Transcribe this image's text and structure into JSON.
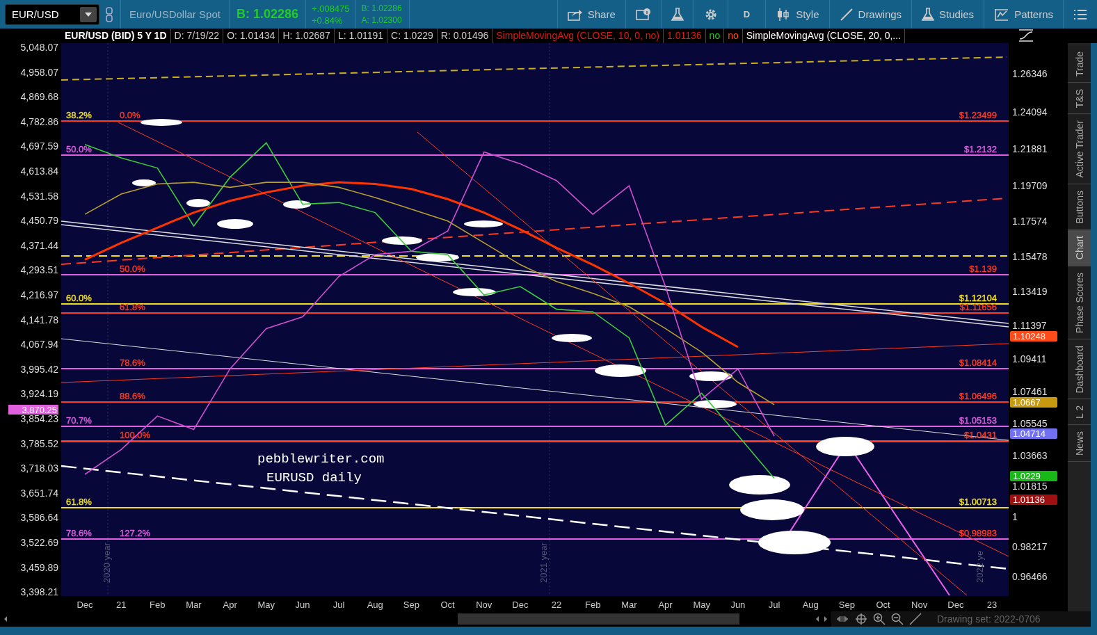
{
  "toolbar": {
    "symbol": "EUR/USD",
    "description": "Euro/USDollar Spot",
    "bid_large": "B: 1.02286",
    "change": "+.008475",
    "change_percent": "+0.84%",
    "bid": "B: 1.02286",
    "ask": "A: 1.02300",
    "buttons": [
      {
        "kind": "share",
        "label": "Share"
      },
      {
        "kind": "info"
      },
      {
        "kind": "flask"
      },
      {
        "kind": "gear"
      },
      {
        "kind": "text",
        "label": "D"
      },
      {
        "kind": "style",
        "label": "Style"
      },
      {
        "kind": "drawings",
        "label": "Drawings"
      },
      {
        "kind": "flask",
        "label": "Studies"
      },
      {
        "kind": "patterns",
        "label": "Patterns"
      },
      {
        "kind": "menu"
      }
    ]
  },
  "header": {
    "title": "EUR/USD (BID) 5 Y 1D",
    "fields": [
      "D: 7/19/22",
      "O: 1.01434",
      "H: 1.02687",
      "L: 1.01191",
      "C: 1.0229",
      "R: 0.01496"
    ],
    "studies": [
      {
        "text": "SimpleMovingAvg (CLOSE, 10, 0, no)",
        "kind": "name"
      },
      {
        "text": "1.01136",
        "kind": "value"
      },
      {
        "text": "no",
        "kind": "flag"
      },
      {
        "text": "no",
        "kind": "alert"
      },
      {
        "text": "SimpleMovingAvg (CLOSE, 20, 0,...",
        "kind": "active_name"
      }
    ]
  },
  "left_axis": {
    "ticks": [
      "5,048.07",
      "4,958.07",
      "4,869.68",
      "4,782.86",
      "4,697.59",
      "4,613.84",
      "4,531.58",
      "4,450.79",
      "4,371.44",
      "4,293.51",
      "4,216.97",
      "4,141.78",
      "4,067.94",
      "3,995.42",
      "3,924.19",
      "3,854.23",
      "3,785.52",
      "3,718.03",
      "3,651.74",
      "3,586.64",
      "3,522.69",
      "3,459.89",
      "3,398.21"
    ],
    "badge": {
      "text": "3,870.25",
      "color": "#e060e0"
    }
  },
  "chart_data": {
    "type": "line",
    "categories": [
      "Dec",
      "21",
      "Feb",
      "Mar",
      "Apr",
      "May",
      "Jun",
      "Jul",
      "Aug",
      "Sep",
      "Oct",
      "Nov",
      "Dec",
      "22",
      "Feb",
      "Mar",
      "Apr",
      "May",
      "Jun",
      "Jul",
      "Aug",
      "Sep",
      "Oct",
      "Nov",
      "Dec",
      "23"
    ],
    "series": [
      {
        "color": "#3ccc3c",
        "values": [
          1.2215,
          1.2135,
          1.2075,
          1.173,
          1.202,
          1.2225,
          1.186,
          1.187,
          1.181,
          1.158,
          1.156,
          1.132,
          1.137,
          1.1235,
          1.122,
          1.1065,
          1.0545,
          1.0735,
          1.0485,
          1.0229,
          null,
          null,
          null,
          null,
          null,
          null
        ]
      },
      {
        "color": "#ff3300",
        "values": [
          1.153,
          1.163,
          1.172,
          1.181,
          1.188,
          1.193,
          1.197,
          1.199,
          1.198,
          1.195,
          1.189,
          1.181,
          1.171,
          1.16,
          1.15,
          1.139,
          1.127,
          1.113,
          1.101,
          null,
          null,
          null,
          null,
          null,
          null,
          null
        ]
      },
      {
        "color": "#b8a030",
        "values": [
          1.18,
          1.192,
          1.198,
          1.199,
          1.196,
          1.199,
          1.199,
          1.196,
          1.19,
          1.183,
          1.176,
          1.163,
          1.15,
          1.14,
          1.133,
          1.125,
          1.112,
          1.098,
          1.08,
          1.0667,
          null,
          null,
          null,
          null,
          null,
          null
        ]
      },
      {
        "color": "#d050d0",
        "values": [
          1.0253,
          1.04,
          1.06,
          1.052,
          1.088,
          1.112,
          1.119,
          1.143,
          1.156,
          1.158,
          1.17,
          1.217,
          1.21,
          1.2,
          1.18,
          1.197,
          1.137,
          1.07,
          1.088,
          1.048,
          null,
          null,
          null,
          null,
          null,
          null
        ]
      }
    ],
    "ylim": [
      0.9533,
      1.2818
    ],
    "yticks": [
      {
        "value": 1.26346,
        "label": "1.26346"
      },
      {
        "value": 1.24094,
        "label": "1.24094"
      },
      {
        "value": 1.21881,
        "label": "1.21881"
      },
      {
        "value": 1.19709,
        "label": "1.19709"
      },
      {
        "value": 1.17574,
        "label": "1.17574"
      },
      {
        "value": 1.15478,
        "label": "1.15478"
      },
      {
        "value": 1.13419,
        "label": "1.13419"
      },
      {
        "value": 1.11397,
        "label": "1.11397"
      },
      {
        "value": 1.09411,
        "label": "1.09411"
      },
      {
        "value": 1.07461,
        "label": "1.07461"
      },
      {
        "value": 1.05545,
        "label": "1.05545"
      },
      {
        "value": 1.03663,
        "label": "1.03663"
      },
      {
        "value": 1.01815,
        "label": "1.01815"
      },
      {
        "value": 1,
        "label": "1"
      },
      {
        "value": 0.98217,
        "label": "0.98217"
      },
      {
        "value": 0.96466,
        "label": "0.96466"
      }
    ]
  },
  "fib_levels": [
    {
      "color": "#ff3b1f",
      "outer": {
        "text": "38.2%",
        "color": "#f0e020"
      },
      "inner": {
        "text": "0.0%",
        "color": "#ff3b1f"
      },
      "price": {
        "text": "$1.23499",
        "color": "#ff3b1f"
      }
    },
    {
      "color": "#e060e0",
      "outer": {
        "text": "50.0%",
        "color": "#e060e0"
      },
      "price": {
        "text": "$1.2132",
        "color": "#e060e0"
      }
    },
    {
      "color": "#e060e0",
      "inner": {
        "text": "50.0%",
        "color": "#ff3b1f"
      },
      "price": {
        "text": "$1.139",
        "color": "#ff3b1f"
      }
    },
    {
      "color": "#f0e020",
      "outer": {
        "text": "60.0%",
        "color": "#f0e020"
      },
      "price": {
        "text": "$1.12104",
        "color": "#f0e020"
      }
    },
    {
      "color": "#ff3b1f",
      "inner": {
        "text": "61.8%",
        "color": "#ff3b1f"
      },
      "price": {
        "text": "$1.11656",
        "color": "#ff3b1f"
      }
    },
    {
      "color": "#e060e0",
      "inner": {
        "text": "78.6%",
        "color": "#ff3b1f"
      },
      "price": {
        "text": "$1.08414",
        "color": "#ff3b1f"
      }
    },
    {
      "color": "#ff3b1f",
      "inner": {
        "text": "88.6%",
        "color": "#ff3b1f"
      },
      "price": {
        "text": "$1.06496",
        "color": "#ff3b1f"
      }
    },
    {
      "color": "#e060e0",
      "outer": {
        "text": "70.7%",
        "color": "#e060e0"
      },
      "price": {
        "text": "$1.05153",
        "color": "#e060e0"
      }
    },
    {
      "color": "#ff3b1f",
      "inner": {
        "text": "100.0%",
        "color": "#ff3b1f"
      },
      "price": {
        "text": "$1.0431",
        "color": "#ff3b1f"
      }
    },
    {
      "color": "#f0e020",
      "outer": {
        "text": "61.8%",
        "color": "#f0e020"
      },
      "price": {
        "text": "$1.00713",
        "color": "#f0e020"
      }
    },
    {
      "color": "#e060e0",
      "outer": {
        "text": "78.6%",
        "color": "#e060e0"
      },
      "inner": {
        "text": "127.2%",
        "color": "#e060e0"
      },
      "price": {
        "text": "$0.98983",
        "color": "#ff3b1f"
      }
    }
  ],
  "chart_notes": [
    "pebblewriter.com",
    "EURUSD daily"
  ],
  "year_markers": [
    "2020 year",
    "2021 year",
    "2022 ye"
  ],
  "right_axis_badges": [
    {
      "text": "1.10248",
      "color": "#ff4a1a"
    },
    {
      "text": "1.0667",
      "color": "#c89a10"
    },
    {
      "text": "1.04714",
      "color": "#7070f0"
    },
    {
      "text": "1.0229",
      "color": "#18b818"
    },
    {
      "text": "1.01136",
      "color": "#a01010"
    }
  ],
  "side_tabs": [
    {
      "label": "Trade",
      "selected": false
    },
    {
      "label": "T&S",
      "selected": false
    },
    {
      "label": "Active Trader",
      "selected": false
    },
    {
      "label": "Buttons",
      "selected": false
    },
    {
      "label": "Chart",
      "selected": true
    },
    {
      "label": "Phase Scores",
      "selected": false
    },
    {
      "label": "Dashboard",
      "selected": false
    },
    {
      "label": "L 2",
      "selected": false
    },
    {
      "label": "News",
      "selected": false
    }
  ],
  "status_bar": {
    "drawing_set": "Drawing set: 2022-0706"
  }
}
